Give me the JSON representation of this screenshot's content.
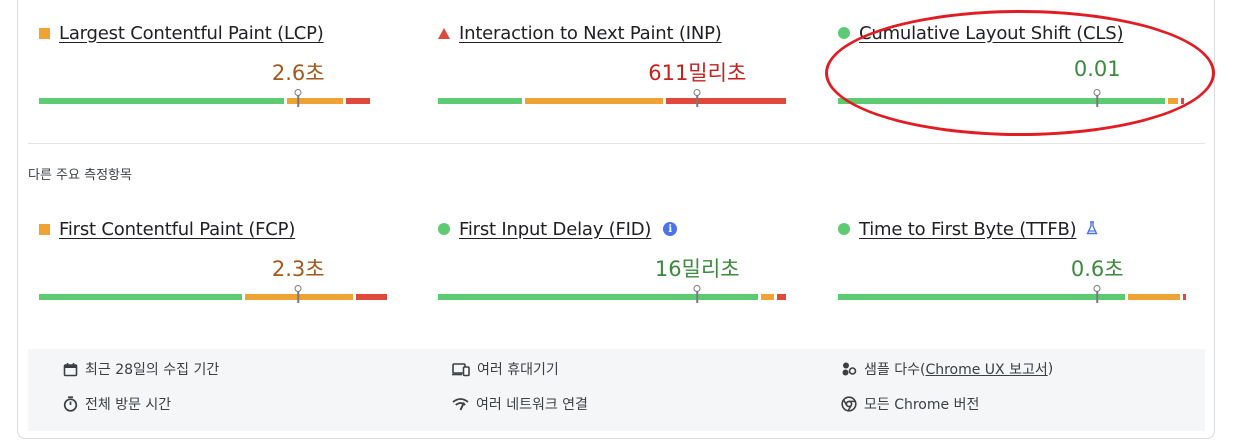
{
  "colors": {
    "good": "#5ccb72",
    "needs_improvement": "#f0a335",
    "poor": "#e0483a",
    "good_text": "#3b8a3e",
    "ni_text": "#a4591c",
    "poor_text": "#c5221f",
    "annotation": "#e31b23"
  },
  "core_metrics": [
    {
      "name": "Largest Contentful Paint (LCP)",
      "value": "2.6초",
      "status": "needs_improvement",
      "marker": "square",
      "percentile": 0.745,
      "segments": [
        0.715,
        0.165,
        0.07
      ]
    },
    {
      "name": "Interaction to Next Paint (INP)",
      "value": "611밀리초",
      "status": "poor",
      "marker": "triangle",
      "percentile": 0.745,
      "segments": [
        0.245,
        0.405,
        0.35
      ]
    },
    {
      "name": "Cumulative Layout Shift (CLS)",
      "value": "0.01",
      "status": "good",
      "marker": "circle",
      "percentile": 0.745,
      "segments": [
        0.955,
        0.03,
        0.01
      ]
    }
  ],
  "other_metrics_label": "다른 주요 측정항목",
  "other_metrics": [
    {
      "name": "First Contentful Paint (FCP)",
      "value": "2.3초",
      "status": "needs_improvement",
      "marker": "square",
      "percentile": 0.745,
      "segments": [
        0.595,
        0.315,
        0.09
      ]
    },
    {
      "name": "First Input Delay (FID)",
      "value": "16밀리초",
      "status": "good",
      "marker": "circle",
      "percentile": 0.745,
      "extra_icon": "info-icon",
      "segments": [
        0.935,
        0.04,
        0.025
      ]
    },
    {
      "name": "Time to First Byte (TTFB)",
      "value": "0.6초",
      "status": "good",
      "marker": "circle",
      "percentile": 0.745,
      "extra_icon": "flask-icon",
      "segments": [
        0.84,
        0.15,
        0.01
      ]
    }
  ],
  "footer": {
    "collection_period": "최근 28일의 수집 기간",
    "devices": "여러 휴대기기",
    "sample_prefix": "샘플 다수(",
    "sample_link": "Chrome UX 보고서",
    "sample_suffix": ")",
    "visit_duration": "전체 방문 시간",
    "networks": "여러 네트워크 연결",
    "chrome_versions": "모든 Chrome 버전"
  }
}
